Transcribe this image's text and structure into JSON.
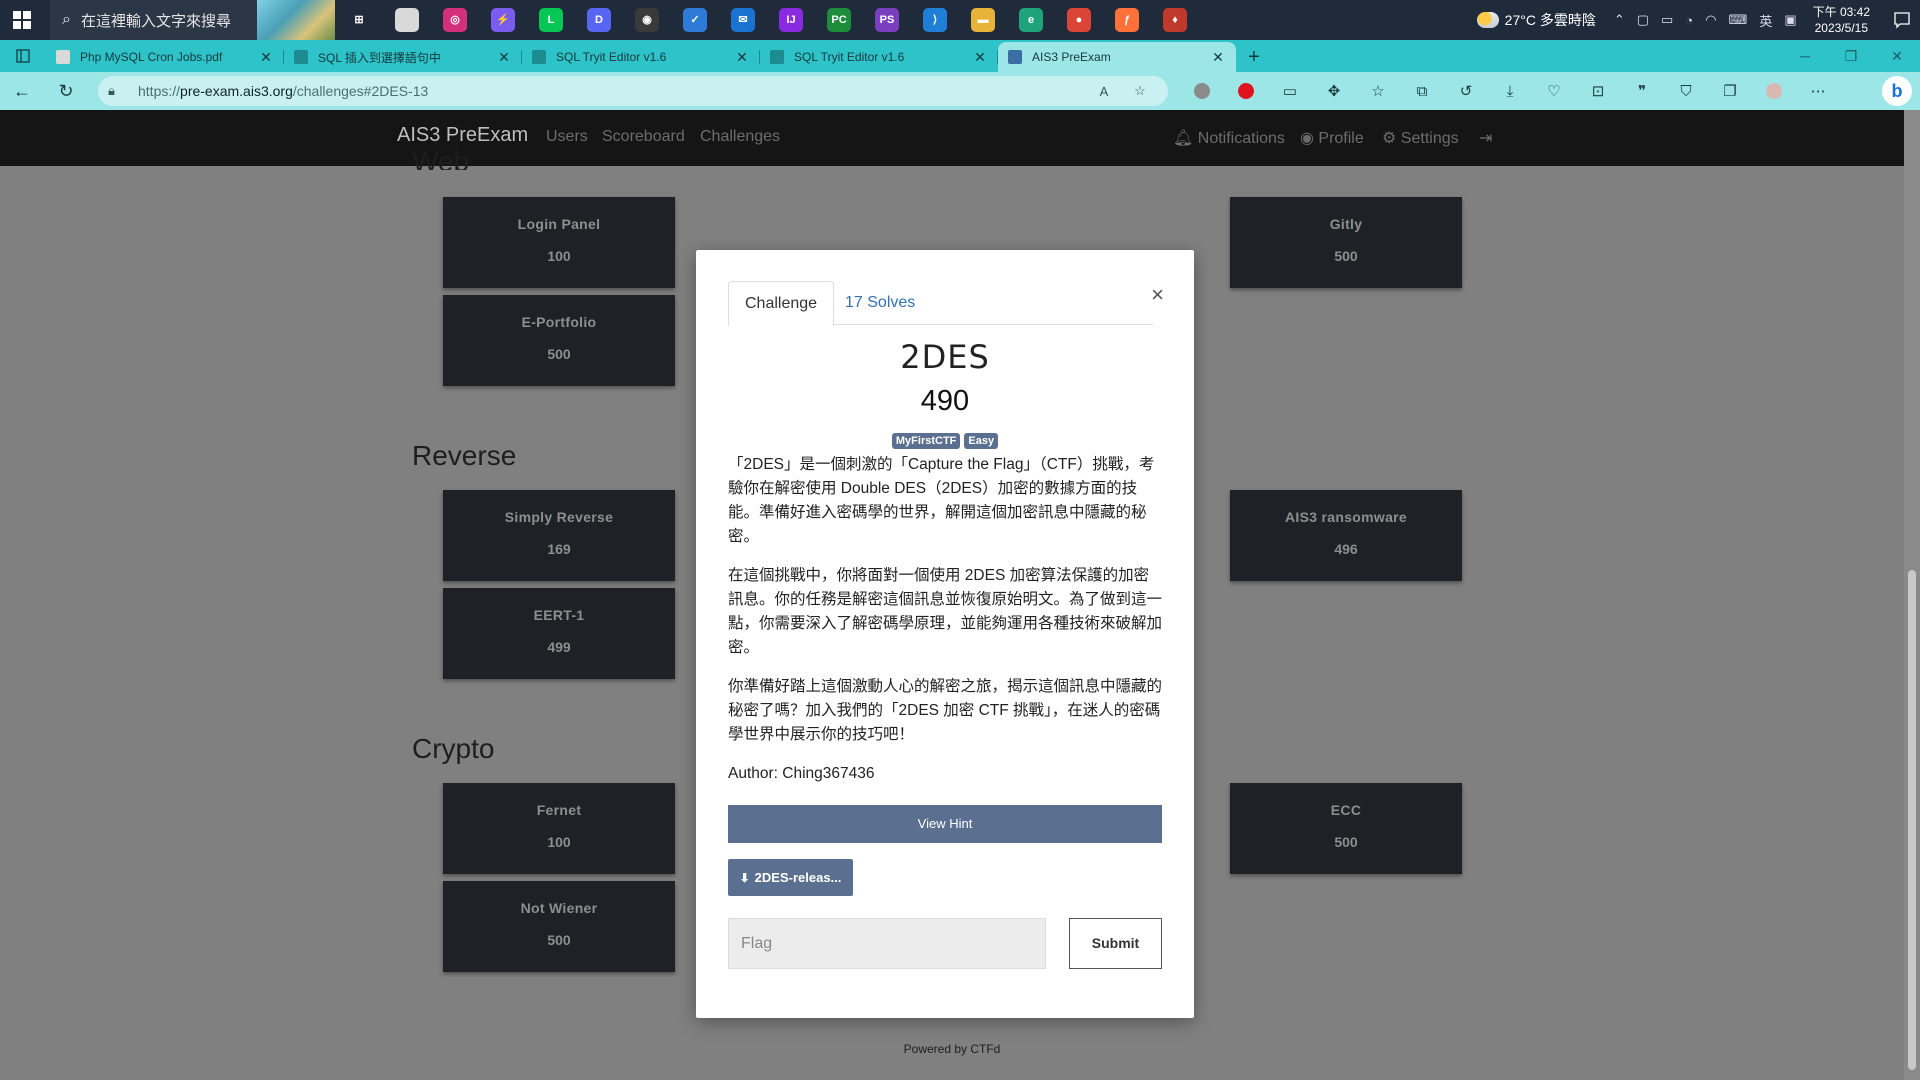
{
  "taskbar": {
    "search_placeholder": "在這裡輸入文字來搜尋",
    "apps": [
      {
        "name": "task-view-icon",
        "glyph": "⊞",
        "color": "#1f2b3a"
      },
      {
        "name": "notepad-icon",
        "glyph": "",
        "color": "#d9d9d9"
      },
      {
        "name": "instagram-icon",
        "glyph": "◎",
        "color": "#d4307a"
      },
      {
        "name": "messenger-icon",
        "glyph": "⚡",
        "color": "#7b5cf0"
      },
      {
        "name": "line-icon",
        "glyph": "L",
        "color": "#06c755"
      },
      {
        "name": "discord-icon",
        "glyph": "D",
        "color": "#5865f2"
      },
      {
        "name": "media-icon",
        "glyph": "◉",
        "color": "#3a3a3a"
      },
      {
        "name": "todo-icon",
        "glyph": "✓",
        "color": "#2d7bd6"
      },
      {
        "name": "mail-icon",
        "glyph": "✉",
        "color": "#1a73d0"
      },
      {
        "name": "intellij-icon",
        "glyph": "IJ",
        "color": "#8a2be2"
      },
      {
        "name": "pycharm-icon",
        "glyph": "PC",
        "color": "#1e8c3a"
      },
      {
        "name": "phpstorm-icon",
        "glyph": "PS",
        "color": "#7a3fbf"
      },
      {
        "name": "vscode-icon",
        "glyph": "⟩",
        "color": "#1f7ed6"
      },
      {
        "name": "explorer-icon",
        "glyph": "▬",
        "color": "#e8b339"
      },
      {
        "name": "edge-icon",
        "glyph": "e",
        "color": "#1fa37a"
      },
      {
        "name": "chrome-icon",
        "glyph": "●",
        "color": "#db4437"
      },
      {
        "name": "firefox-icon",
        "glyph": "ƒ",
        "color": "#ff7139"
      },
      {
        "name": "git-icon",
        "glyph": "♦",
        "color": "#c0392b"
      }
    ],
    "weather": "27°C 多雲時陰",
    "ime": "英",
    "time": "下午 03:42",
    "date": "2023/5/15"
  },
  "browser": {
    "tabs": [
      {
        "title": "Php MySQL Cron Jobs.pdf",
        "fav_color": "#d9d9d9",
        "active": false
      },
      {
        "title": "SQL 插入到選擇語句中",
        "fav_color": "#1d8c91",
        "active": false
      },
      {
        "title": "SQL Tryit Editor v1.6",
        "fav_color": "#1d8c91",
        "active": false
      },
      {
        "title": "SQL Tryit Editor v1.6",
        "fav_color": "#1d8c91",
        "active": false
      },
      {
        "title": "AIS3 PreExam",
        "fav_color": "#3a6ea5",
        "active": true
      }
    ],
    "url_prefix": "https://",
    "url_host": "pre-exam.ais3.org",
    "url_path": "/challenges#2DES-13"
  },
  "site": {
    "brand": "AIS3 PreExam",
    "nav_left": [
      "Users",
      "Scoreboard",
      "Challenges"
    ],
    "nav_right": [
      "Notifications",
      "Profile",
      "Settings"
    ],
    "footer": "Powered by CTFd"
  },
  "categories": [
    {
      "title": "Web",
      "cards": [
        {
          "name": "Login Panel",
          "value": "100"
        },
        {
          "name": "Gitly",
          "value": "500"
        },
        {
          "name": "E-Portfolio",
          "value": "500"
        }
      ]
    },
    {
      "title": "Reverse",
      "cards": [
        {
          "name": "Simply Reverse",
          "value": "169"
        },
        {
          "name": "AIS3 ransomware",
          "value": "496"
        },
        {
          "name": "EERT-1",
          "value": "499"
        }
      ]
    },
    {
      "title": "Crypto",
      "cards": [
        {
          "name": "Fernet",
          "value": "100"
        },
        {
          "name": "ECC",
          "value": "500"
        },
        {
          "name": "Not Wiener",
          "value": "500"
        }
      ]
    }
  ],
  "modal": {
    "tab_challenge": "Challenge",
    "tab_solves": "17 Solves",
    "close": "×",
    "name": "2DES",
    "value": "490",
    "tags": [
      "MyFirstCTF",
      "Easy"
    ],
    "description": [
      "「2DES」是一個刺激的「Capture the Flag」（CTF）挑戰，考驗你在解密使用 Double DES（2DES）加密的數據方面的技能。準備好進入密碼學的世界，解開這個加密訊息中隱藏的秘密。",
      "在這個挑戰中，你將面對一個使用 2DES 加密算法保護的加密訊息。你的任務是解密這個訊息並恢復原始明文。為了做到這一點，你需要深入了解密碼學原理，並能夠運用各種技術來破解加密。",
      "你準備好踏上這個激動人心的解密之旅，揭示這個訊息中隱藏的秘密了嗎？加入我們的「2DES 加密 CTF 挑戰」，在迷人的密碼學世界中展示你的技巧吧！"
    ],
    "author": "Author: Ching367436",
    "hint_label": "View Hint",
    "file_label": "2DES-releas...",
    "flag_placeholder": "Flag",
    "submit_label": "Submit"
  }
}
